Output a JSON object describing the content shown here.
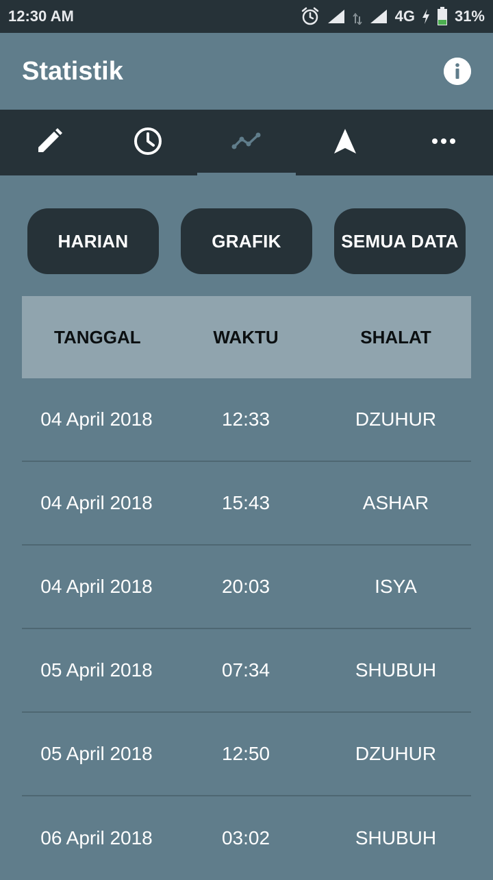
{
  "status_bar": {
    "time": "12:30 AM",
    "network": "4G",
    "battery": "31%",
    "battery_level": 0.31
  },
  "app_bar": {
    "title": "Statistik",
    "info_icon": "info-icon"
  },
  "tabs": [
    {
      "icon": "pencil-icon",
      "active": false
    },
    {
      "icon": "clock-icon",
      "active": false
    },
    {
      "icon": "chart-line-icon",
      "active": true
    },
    {
      "icon": "navigation-arrow-icon",
      "active": false
    },
    {
      "icon": "more-horiz-icon",
      "active": false
    }
  ],
  "segments": {
    "daily": "HARIAN",
    "graph": "GRAFIK",
    "all_data": "SEMUA DATA"
  },
  "table": {
    "headers": [
      "TANGGAL",
      "WAKTU",
      "SHALAT"
    ],
    "rows": [
      {
        "date": "04 April 2018",
        "time": "12:33",
        "prayer": "DZUHUR"
      },
      {
        "date": "04 April 2018",
        "time": "15:43",
        "prayer": "ASHAR"
      },
      {
        "date": "04 April 2018",
        "time": "20:03",
        "prayer": "ISYA"
      },
      {
        "date": "05 April 2018",
        "time": "07:34",
        "prayer": "SHUBUH"
      },
      {
        "date": "05 April 2018",
        "time": "12:50",
        "prayer": "DZUHUR"
      },
      {
        "date": "06 April 2018",
        "time": "03:02",
        "prayer": "SHUBUH"
      }
    ]
  },
  "colors": {
    "background": "#607d8b",
    "dark": "#263238",
    "header_row": "#90a4ae",
    "battery_green": "#4caf50"
  }
}
